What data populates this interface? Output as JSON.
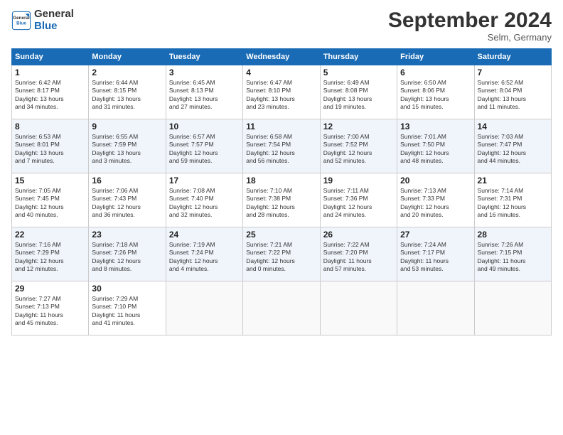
{
  "logo": {
    "general": "General",
    "blue": "Blue"
  },
  "title": "September 2024",
  "location": "Selm, Germany",
  "days_header": [
    "Sunday",
    "Monday",
    "Tuesday",
    "Wednesday",
    "Thursday",
    "Friday",
    "Saturday"
  ],
  "weeks": [
    [
      {
        "day": "1",
        "info": "Sunrise: 6:42 AM\nSunset: 8:17 PM\nDaylight: 13 hours\nand 34 minutes."
      },
      {
        "day": "2",
        "info": "Sunrise: 6:44 AM\nSunset: 8:15 PM\nDaylight: 13 hours\nand 31 minutes."
      },
      {
        "day": "3",
        "info": "Sunrise: 6:45 AM\nSunset: 8:13 PM\nDaylight: 13 hours\nand 27 minutes."
      },
      {
        "day": "4",
        "info": "Sunrise: 6:47 AM\nSunset: 8:10 PM\nDaylight: 13 hours\nand 23 minutes."
      },
      {
        "day": "5",
        "info": "Sunrise: 6:49 AM\nSunset: 8:08 PM\nDaylight: 13 hours\nand 19 minutes."
      },
      {
        "day": "6",
        "info": "Sunrise: 6:50 AM\nSunset: 8:06 PM\nDaylight: 13 hours\nand 15 minutes."
      },
      {
        "day": "7",
        "info": "Sunrise: 6:52 AM\nSunset: 8:04 PM\nDaylight: 13 hours\nand 11 minutes."
      }
    ],
    [
      {
        "day": "8",
        "info": "Sunrise: 6:53 AM\nSunset: 8:01 PM\nDaylight: 13 hours\nand 7 minutes."
      },
      {
        "day": "9",
        "info": "Sunrise: 6:55 AM\nSunset: 7:59 PM\nDaylight: 13 hours\nand 3 minutes."
      },
      {
        "day": "10",
        "info": "Sunrise: 6:57 AM\nSunset: 7:57 PM\nDaylight: 12 hours\nand 59 minutes."
      },
      {
        "day": "11",
        "info": "Sunrise: 6:58 AM\nSunset: 7:54 PM\nDaylight: 12 hours\nand 56 minutes."
      },
      {
        "day": "12",
        "info": "Sunrise: 7:00 AM\nSunset: 7:52 PM\nDaylight: 12 hours\nand 52 minutes."
      },
      {
        "day": "13",
        "info": "Sunrise: 7:01 AM\nSunset: 7:50 PM\nDaylight: 12 hours\nand 48 minutes."
      },
      {
        "day": "14",
        "info": "Sunrise: 7:03 AM\nSunset: 7:47 PM\nDaylight: 12 hours\nand 44 minutes."
      }
    ],
    [
      {
        "day": "15",
        "info": "Sunrise: 7:05 AM\nSunset: 7:45 PM\nDaylight: 12 hours\nand 40 minutes."
      },
      {
        "day": "16",
        "info": "Sunrise: 7:06 AM\nSunset: 7:43 PM\nDaylight: 12 hours\nand 36 minutes."
      },
      {
        "day": "17",
        "info": "Sunrise: 7:08 AM\nSunset: 7:40 PM\nDaylight: 12 hours\nand 32 minutes."
      },
      {
        "day": "18",
        "info": "Sunrise: 7:10 AM\nSunset: 7:38 PM\nDaylight: 12 hours\nand 28 minutes."
      },
      {
        "day": "19",
        "info": "Sunrise: 7:11 AM\nSunset: 7:36 PM\nDaylight: 12 hours\nand 24 minutes."
      },
      {
        "day": "20",
        "info": "Sunrise: 7:13 AM\nSunset: 7:33 PM\nDaylight: 12 hours\nand 20 minutes."
      },
      {
        "day": "21",
        "info": "Sunrise: 7:14 AM\nSunset: 7:31 PM\nDaylight: 12 hours\nand 16 minutes."
      }
    ],
    [
      {
        "day": "22",
        "info": "Sunrise: 7:16 AM\nSunset: 7:29 PM\nDaylight: 12 hours\nand 12 minutes."
      },
      {
        "day": "23",
        "info": "Sunrise: 7:18 AM\nSunset: 7:26 PM\nDaylight: 12 hours\nand 8 minutes."
      },
      {
        "day": "24",
        "info": "Sunrise: 7:19 AM\nSunset: 7:24 PM\nDaylight: 12 hours\nand 4 minutes."
      },
      {
        "day": "25",
        "info": "Sunrise: 7:21 AM\nSunset: 7:22 PM\nDaylight: 12 hours\nand 0 minutes."
      },
      {
        "day": "26",
        "info": "Sunrise: 7:22 AM\nSunset: 7:20 PM\nDaylight: 11 hours\nand 57 minutes."
      },
      {
        "day": "27",
        "info": "Sunrise: 7:24 AM\nSunset: 7:17 PM\nDaylight: 11 hours\nand 53 minutes."
      },
      {
        "day": "28",
        "info": "Sunrise: 7:26 AM\nSunset: 7:15 PM\nDaylight: 11 hours\nand 49 minutes."
      }
    ],
    [
      {
        "day": "29",
        "info": "Sunrise: 7:27 AM\nSunset: 7:13 PM\nDaylight: 11 hours\nand 45 minutes."
      },
      {
        "day": "30",
        "info": "Sunrise: 7:29 AM\nSunset: 7:10 PM\nDaylight: 11 hours\nand 41 minutes."
      },
      null,
      null,
      null,
      null,
      null
    ]
  ]
}
